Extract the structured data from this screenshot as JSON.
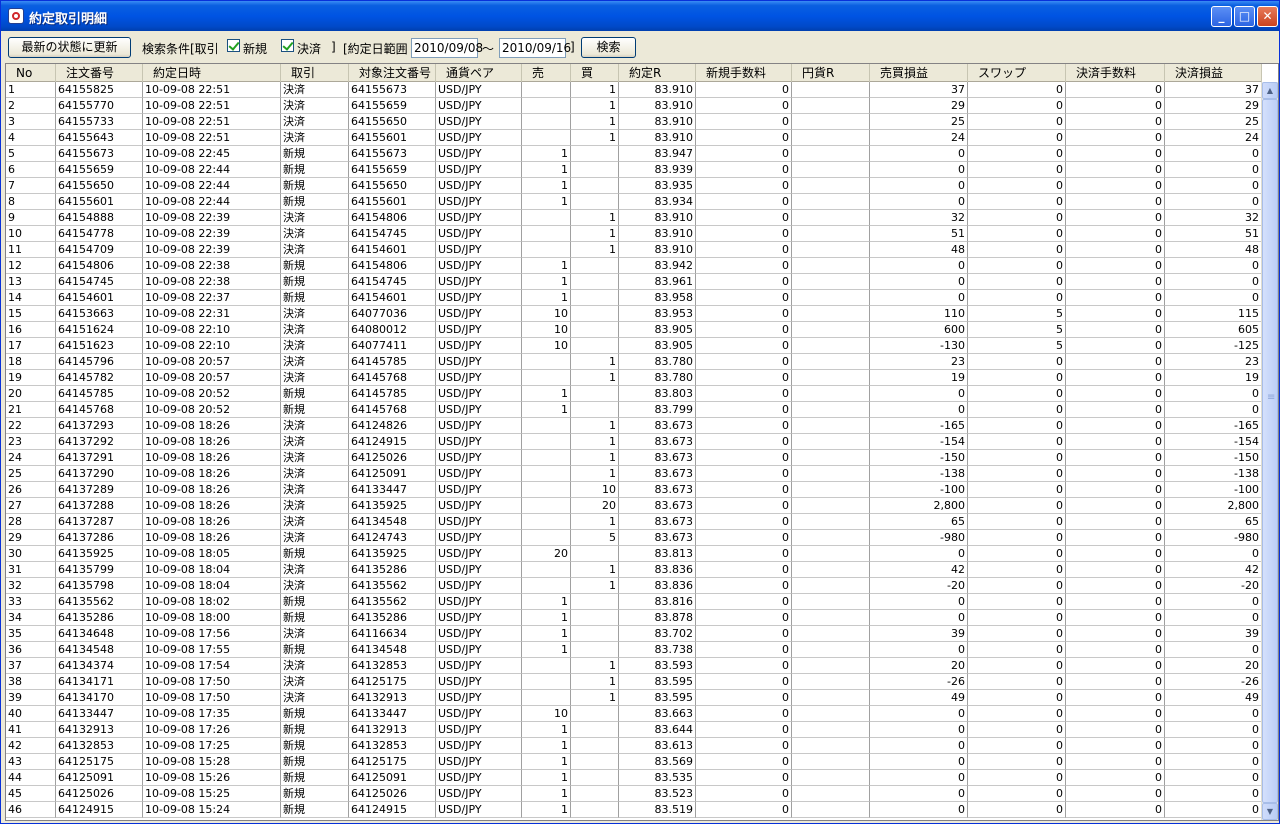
{
  "window": {
    "title": "約定取引明細",
    "buttons": {
      "minimize": "_",
      "maximize": "□",
      "close": "✕"
    }
  },
  "toolbar": {
    "refresh_label": "最新の状態に更新",
    "search_cond_label": "検索条件[取引",
    "new_label": "新規",
    "settle_label": "決済",
    "bracket_close": "]",
    "date_range_label": "[約定日範囲",
    "date_from": "2010/09/08",
    "tilde": "～",
    "date_to": "2010/09/16",
    "bracket_close2": "]",
    "search_label": "検索"
  },
  "table": {
    "columns": [
      "No",
      "注文番号",
      "約定日時",
      "取引",
      "対象注文番号",
      "通貨ペア",
      "売",
      "買",
      "約定R",
      "新規手数料",
      "円貨R",
      "売買損益",
      "スワップ",
      "決済手数料",
      "決済損益"
    ],
    "rows": [
      [
        "1",
        "64155825",
        "10-09-08 22:51",
        "決済",
        "64155673",
        "USD/JPY",
        "",
        "1",
        "83.910",
        "0",
        "",
        "37",
        "0",
        "0",
        "37"
      ],
      [
        "2",
        "64155770",
        "10-09-08 22:51",
        "決済",
        "64155659",
        "USD/JPY",
        "",
        "1",
        "83.910",
        "0",
        "",
        "29",
        "0",
        "0",
        "29"
      ],
      [
        "3",
        "64155733",
        "10-09-08 22:51",
        "決済",
        "64155650",
        "USD/JPY",
        "",
        "1",
        "83.910",
        "0",
        "",
        "25",
        "0",
        "0",
        "25"
      ],
      [
        "4",
        "64155643",
        "10-09-08 22:51",
        "決済",
        "64155601",
        "USD/JPY",
        "",
        "1",
        "83.910",
        "0",
        "",
        "24",
        "0",
        "0",
        "24"
      ],
      [
        "5",
        "64155673",
        "10-09-08 22:45",
        "新規",
        "64155673",
        "USD/JPY",
        "1",
        "",
        "83.947",
        "0",
        "",
        "0",
        "0",
        "0",
        "0"
      ],
      [
        "6",
        "64155659",
        "10-09-08 22:44",
        "新規",
        "64155659",
        "USD/JPY",
        "1",
        "",
        "83.939",
        "0",
        "",
        "0",
        "0",
        "0",
        "0"
      ],
      [
        "7",
        "64155650",
        "10-09-08 22:44",
        "新規",
        "64155650",
        "USD/JPY",
        "1",
        "",
        "83.935",
        "0",
        "",
        "0",
        "0",
        "0",
        "0"
      ],
      [
        "8",
        "64155601",
        "10-09-08 22:44",
        "新規",
        "64155601",
        "USD/JPY",
        "1",
        "",
        "83.934",
        "0",
        "",
        "0",
        "0",
        "0",
        "0"
      ],
      [
        "9",
        "64154888",
        "10-09-08 22:39",
        "決済",
        "64154806",
        "USD/JPY",
        "",
        "1",
        "83.910",
        "0",
        "",
        "32",
        "0",
        "0",
        "32"
      ],
      [
        "10",
        "64154778",
        "10-09-08 22:39",
        "決済",
        "64154745",
        "USD/JPY",
        "",
        "1",
        "83.910",
        "0",
        "",
        "51",
        "0",
        "0",
        "51"
      ],
      [
        "11",
        "64154709",
        "10-09-08 22:39",
        "決済",
        "64154601",
        "USD/JPY",
        "",
        "1",
        "83.910",
        "0",
        "",
        "48",
        "0",
        "0",
        "48"
      ],
      [
        "12",
        "64154806",
        "10-09-08 22:38",
        "新規",
        "64154806",
        "USD/JPY",
        "1",
        "",
        "83.942",
        "0",
        "",
        "0",
        "0",
        "0",
        "0"
      ],
      [
        "13",
        "64154745",
        "10-09-08 22:38",
        "新規",
        "64154745",
        "USD/JPY",
        "1",
        "",
        "83.961",
        "0",
        "",
        "0",
        "0",
        "0",
        "0"
      ],
      [
        "14",
        "64154601",
        "10-09-08 22:37",
        "新規",
        "64154601",
        "USD/JPY",
        "1",
        "",
        "83.958",
        "0",
        "",
        "0",
        "0",
        "0",
        "0"
      ],
      [
        "15",
        "64153663",
        "10-09-08 22:31",
        "決済",
        "64077036",
        "USD/JPY",
        "10",
        "",
        "83.953",
        "0",
        "",
        "110",
        "5",
        "0",
        "115"
      ],
      [
        "16",
        "64151624",
        "10-09-08 22:10",
        "決済",
        "64080012",
        "USD/JPY",
        "10",
        "",
        "83.905",
        "0",
        "",
        "600",
        "5",
        "0",
        "605"
      ],
      [
        "17",
        "64151623",
        "10-09-08 22:10",
        "決済",
        "64077411",
        "USD/JPY",
        "10",
        "",
        "83.905",
        "0",
        "",
        "-130",
        "5",
        "0",
        "-125"
      ],
      [
        "18",
        "64145796",
        "10-09-08 20:57",
        "決済",
        "64145785",
        "USD/JPY",
        "",
        "1",
        "83.780",
        "0",
        "",
        "23",
        "0",
        "0",
        "23"
      ],
      [
        "19",
        "64145782",
        "10-09-08 20:57",
        "決済",
        "64145768",
        "USD/JPY",
        "",
        "1",
        "83.780",
        "0",
        "",
        "19",
        "0",
        "0",
        "19"
      ],
      [
        "20",
        "64145785",
        "10-09-08 20:52",
        "新規",
        "64145785",
        "USD/JPY",
        "1",
        "",
        "83.803",
        "0",
        "",
        "0",
        "0",
        "0",
        "0"
      ],
      [
        "21",
        "64145768",
        "10-09-08 20:52",
        "新規",
        "64145768",
        "USD/JPY",
        "1",
        "",
        "83.799",
        "0",
        "",
        "0",
        "0",
        "0",
        "0"
      ],
      [
        "22",
        "64137293",
        "10-09-08 18:26",
        "決済",
        "64124826",
        "USD/JPY",
        "",
        "1",
        "83.673",
        "0",
        "",
        "-165",
        "0",
        "0",
        "-165"
      ],
      [
        "23",
        "64137292",
        "10-09-08 18:26",
        "決済",
        "64124915",
        "USD/JPY",
        "",
        "1",
        "83.673",
        "0",
        "",
        "-154",
        "0",
        "0",
        "-154"
      ],
      [
        "24",
        "64137291",
        "10-09-08 18:26",
        "決済",
        "64125026",
        "USD/JPY",
        "",
        "1",
        "83.673",
        "0",
        "",
        "-150",
        "0",
        "0",
        "-150"
      ],
      [
        "25",
        "64137290",
        "10-09-08 18:26",
        "決済",
        "64125091",
        "USD/JPY",
        "",
        "1",
        "83.673",
        "0",
        "",
        "-138",
        "0",
        "0",
        "-138"
      ],
      [
        "26",
        "64137289",
        "10-09-08 18:26",
        "決済",
        "64133447",
        "USD/JPY",
        "",
        "10",
        "83.673",
        "0",
        "",
        "-100",
        "0",
        "0",
        "-100"
      ],
      [
        "27",
        "64137288",
        "10-09-08 18:26",
        "決済",
        "64135925",
        "USD/JPY",
        "",
        "20",
        "83.673",
        "0",
        "",
        "2,800",
        "0",
        "0",
        "2,800"
      ],
      [
        "28",
        "64137287",
        "10-09-08 18:26",
        "決済",
        "64134548",
        "USD/JPY",
        "",
        "1",
        "83.673",
        "0",
        "",
        "65",
        "0",
        "0",
        "65"
      ],
      [
        "29",
        "64137286",
        "10-09-08 18:26",
        "決済",
        "64124743",
        "USD/JPY",
        "",
        "5",
        "83.673",
        "0",
        "",
        "-980",
        "0",
        "0",
        "-980"
      ],
      [
        "30",
        "64135925",
        "10-09-08 18:05",
        "新規",
        "64135925",
        "USD/JPY",
        "20",
        "",
        "83.813",
        "0",
        "",
        "0",
        "0",
        "0",
        "0"
      ],
      [
        "31",
        "64135799",
        "10-09-08 18:04",
        "決済",
        "64135286",
        "USD/JPY",
        "",
        "1",
        "83.836",
        "0",
        "",
        "42",
        "0",
        "0",
        "42"
      ],
      [
        "32",
        "64135798",
        "10-09-08 18:04",
        "決済",
        "64135562",
        "USD/JPY",
        "",
        "1",
        "83.836",
        "0",
        "",
        "-20",
        "0",
        "0",
        "-20"
      ],
      [
        "33",
        "64135562",
        "10-09-08 18:02",
        "新規",
        "64135562",
        "USD/JPY",
        "1",
        "",
        "83.816",
        "0",
        "",
        "0",
        "0",
        "0",
        "0"
      ],
      [
        "34",
        "64135286",
        "10-09-08 18:00",
        "新規",
        "64135286",
        "USD/JPY",
        "1",
        "",
        "83.878",
        "0",
        "",
        "0",
        "0",
        "0",
        "0"
      ],
      [
        "35",
        "64134648",
        "10-09-08 17:56",
        "決済",
        "64116634",
        "USD/JPY",
        "1",
        "",
        "83.702",
        "0",
        "",
        "39",
        "0",
        "0",
        "39"
      ],
      [
        "36",
        "64134548",
        "10-09-08 17:55",
        "新規",
        "64134548",
        "USD/JPY",
        "1",
        "",
        "83.738",
        "0",
        "",
        "0",
        "0",
        "0",
        "0"
      ],
      [
        "37",
        "64134374",
        "10-09-08 17:54",
        "決済",
        "64132853",
        "USD/JPY",
        "",
        "1",
        "83.593",
        "0",
        "",
        "20",
        "0",
        "0",
        "20"
      ],
      [
        "38",
        "64134171",
        "10-09-08 17:50",
        "決済",
        "64125175",
        "USD/JPY",
        "",
        "1",
        "83.595",
        "0",
        "",
        "-26",
        "0",
        "0",
        "-26"
      ],
      [
        "39",
        "64134170",
        "10-09-08 17:50",
        "決済",
        "64132913",
        "USD/JPY",
        "",
        "1",
        "83.595",
        "0",
        "",
        "49",
        "0",
        "0",
        "49"
      ],
      [
        "40",
        "64133447",
        "10-09-08 17:35",
        "新規",
        "64133447",
        "USD/JPY",
        "10",
        "",
        "83.663",
        "0",
        "",
        "0",
        "0",
        "0",
        "0"
      ],
      [
        "41",
        "64132913",
        "10-09-08 17:26",
        "新規",
        "64132913",
        "USD/JPY",
        "1",
        "",
        "83.644",
        "0",
        "",
        "0",
        "0",
        "0",
        "0"
      ],
      [
        "42",
        "64132853",
        "10-09-08 17:25",
        "新規",
        "64132853",
        "USD/JPY",
        "1",
        "",
        "83.613",
        "0",
        "",
        "0",
        "0",
        "0",
        "0"
      ],
      [
        "43",
        "64125175",
        "10-09-08 15:28",
        "新規",
        "64125175",
        "USD/JPY",
        "1",
        "",
        "83.569",
        "0",
        "",
        "0",
        "0",
        "0",
        "0"
      ],
      [
        "44",
        "64125091",
        "10-09-08 15:26",
        "新規",
        "64125091",
        "USD/JPY",
        "1",
        "",
        "83.535",
        "0",
        "",
        "0",
        "0",
        "0",
        "0"
      ],
      [
        "45",
        "64125026",
        "10-09-08 15:25",
        "新規",
        "64125026",
        "USD/JPY",
        "1",
        "",
        "83.523",
        "0",
        "",
        "0",
        "0",
        "0",
        "0"
      ],
      [
        "46",
        "64124915",
        "10-09-08 15:24",
        "新規",
        "64124915",
        "USD/JPY",
        "1",
        "",
        "83.519",
        "0",
        "",
        "0",
        "0",
        "0",
        "0"
      ]
    ]
  },
  "scrollbar": {
    "up_arrow": "▲",
    "down_arrow": "▼"
  },
  "colors": {
    "titlebar": "#0054e3",
    "face": "#ece9d8",
    "check": "#21a121"
  }
}
